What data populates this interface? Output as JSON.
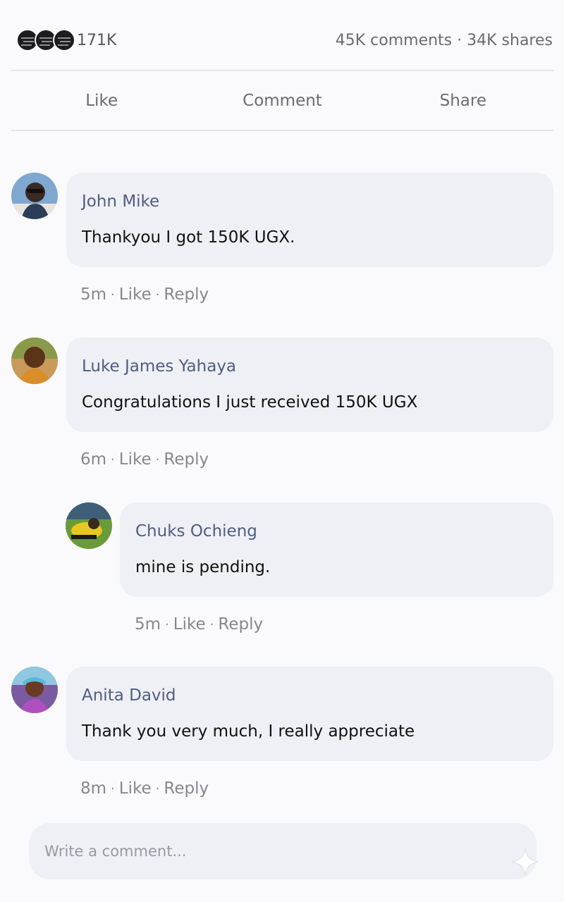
{
  "stats": {
    "reaction_count": "171K",
    "comments_shares": "45K comments · 34K shares",
    "reaction_icons": [
      "reaction-icon",
      "reaction-icon",
      "reaction-icon"
    ]
  },
  "actions": {
    "like": "Like",
    "comment": "Comment",
    "share": "Share"
  },
  "comments": [
    {
      "author": "John Mike",
      "text": "Thankyou I got 150K UGX.",
      "time": "5m",
      "like": "Like",
      "reply": "Reply"
    },
    {
      "author": "Luke James Yahaya",
      "text": "Congratulations I just received 150K UGX",
      "time": "6m",
      "like": "Like",
      "reply": "Reply"
    },
    {
      "author": "Chuks Ochieng",
      "text": "mine is pending.",
      "time": "5m",
      "like": "Like",
      "reply": "Reply"
    },
    {
      "author": "Anita David",
      "text": "Thank you very much, I really appreciate",
      "time": "8m",
      "like": "Like",
      "reply": "Reply"
    }
  ],
  "composer": {
    "placeholder": "Write a comment..."
  },
  "colors": {
    "author": "#4f5d83",
    "bubble": "#eef0f5",
    "meta": "#87878c"
  }
}
